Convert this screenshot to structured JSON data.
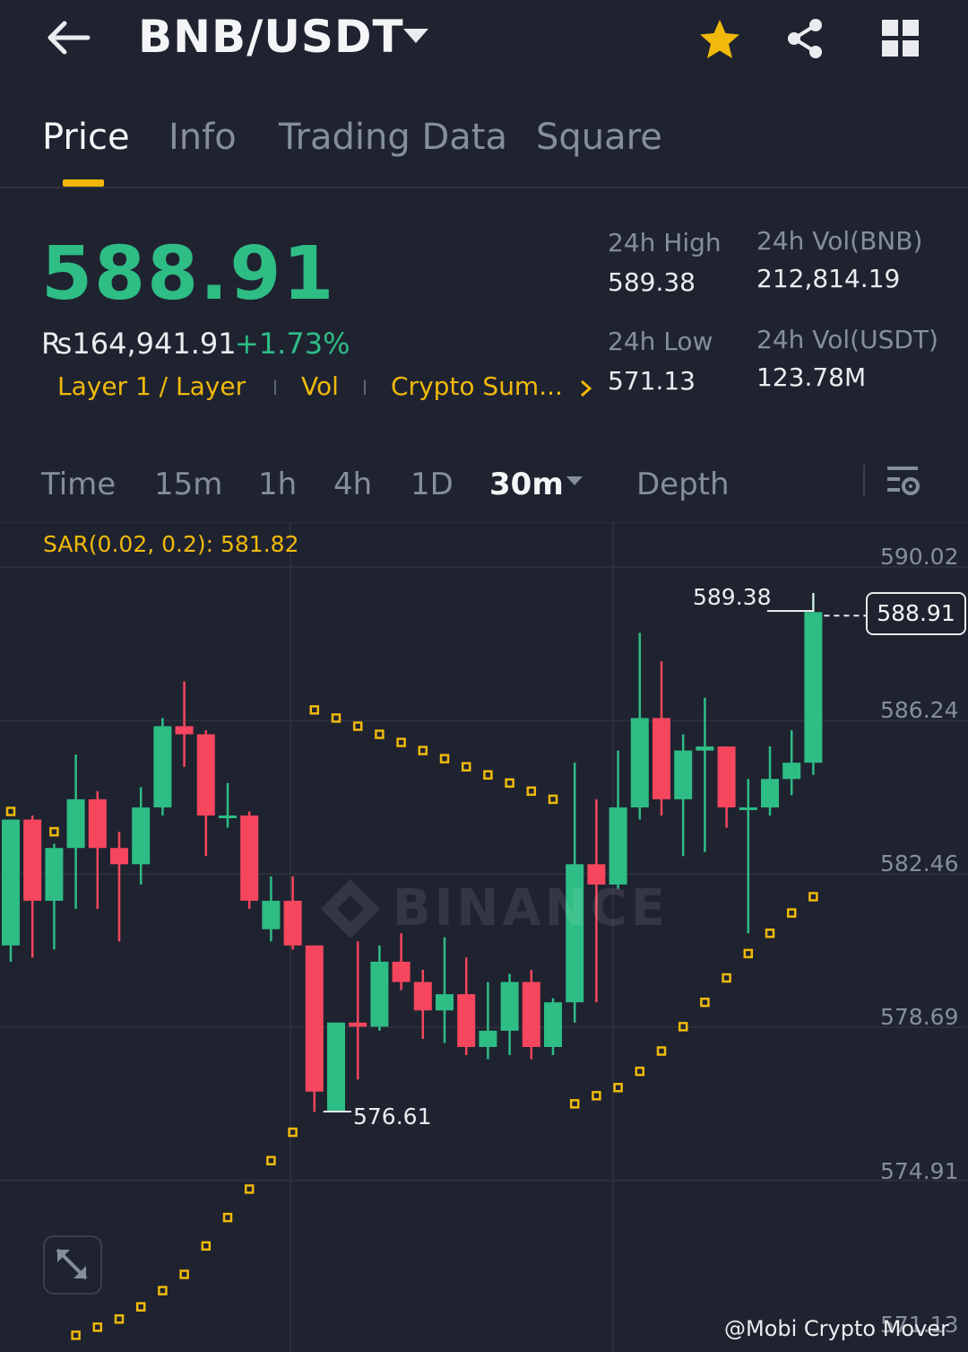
{
  "header": {
    "pair": "BNB/USDT",
    "back_icon": "arrow-left-icon",
    "star_icon": "star-icon",
    "share_icon": "share-icon",
    "grid_icon": "grid-icon"
  },
  "tabs": [
    {
      "label": "Price",
      "active": true
    },
    {
      "label": "Info",
      "active": false
    },
    {
      "label": "Trading Data",
      "active": false
    },
    {
      "label": "Square",
      "active": false
    }
  ],
  "price": {
    "last": "588.91",
    "fiat": "₨164,941.91",
    "change": "+1.73%"
  },
  "tags": [
    "Layer 1 / Layer",
    "Vol",
    "Crypto Sum..."
  ],
  "stats": {
    "high_label": "24h High",
    "high_value": "589.38",
    "low_label": "24h Low",
    "low_value": "571.13",
    "vol_bnb_label": "24h Vol(BNB)",
    "vol_bnb_value": "212,814.19",
    "vol_usdt_label": "24h Vol(USDT)",
    "vol_usdt_value": "123.78M"
  },
  "intervals": [
    {
      "label": "Time",
      "active": false
    },
    {
      "label": "15m",
      "active": false
    },
    {
      "label": "1h",
      "active": false
    },
    {
      "label": "4h",
      "active": false
    },
    {
      "label": "1D",
      "active": false
    },
    {
      "label": "30m",
      "active": true
    },
    {
      "label": "Depth",
      "active": false
    }
  ],
  "chart": {
    "sar_label": "SAR(0.02, 0.2): 581.82",
    "current_price": "588.91",
    "high_marker": "589.38",
    "low_marker": "576.61",
    "watermark": "BINANCE",
    "credit": "@Mobi Crypto Mover",
    "y_labels": [
      "590.02",
      "586.24",
      "582.46",
      "578.69",
      "574.91",
      "571.13"
    ]
  },
  "colors": {
    "background": "#1f2330",
    "up": "#2ebd85",
    "down": "#f6465d",
    "accent": "#f0b90b"
  },
  "chart_data": {
    "type": "candlestick",
    "title": "",
    "ylim": [
      570.0,
      591.0
    ],
    "y_ticks": [
      590.02,
      586.24,
      582.46,
      578.69,
      574.91,
      571.13
    ],
    "candles": [
      {
        "o": 580.7,
        "h": 583.7,
        "l": 580.3,
        "c": 583.8
      },
      {
        "o": 583.8,
        "h": 583.9,
        "l": 580.4,
        "c": 581.8
      },
      {
        "o": 581.8,
        "h": 583.2,
        "l": 580.6,
        "c": 583.1
      },
      {
        "o": 583.1,
        "h": 585.4,
        "l": 581.6,
        "c": 584.3
      },
      {
        "o": 584.3,
        "h": 584.5,
        "l": 581.6,
        "c": 583.1
      },
      {
        "o": 583.1,
        "h": 583.5,
        "l": 580.8,
        "c": 582.7
      },
      {
        "o": 582.7,
        "h": 584.6,
        "l": 582.2,
        "c": 584.1
      },
      {
        "o": 584.1,
        "h": 586.3,
        "l": 583.9,
        "c": 586.1
      },
      {
        "o": 586.1,
        "h": 587.2,
        "l": 585.1,
        "c": 585.9
      },
      {
        "o": 585.9,
        "h": 586.0,
        "l": 582.9,
        "c": 583.9
      },
      {
        "o": 583.9,
        "h": 584.7,
        "l": 583.6,
        "c": 583.9
      },
      {
        "o": 583.9,
        "h": 584.0,
        "l": 581.6,
        "c": 581.8
      },
      {
        "o": 581.1,
        "h": 582.4,
        "l": 580.8,
        "c": 581.8
      },
      {
        "o": 581.8,
        "h": 582.4,
        "l": 580.6,
        "c": 580.7
      },
      {
        "o": 580.7,
        "h": 580.6,
        "l": 576.6,
        "c": 577.1
      },
      {
        "o": 576.6,
        "h": 578.7,
        "l": 576.8,
        "c": 578.8
      },
      {
        "o": 578.8,
        "h": 580.8,
        "l": 577.4,
        "c": 578.7
      },
      {
        "o": 578.7,
        "h": 580.7,
        "l": 578.6,
        "c": 580.3
      },
      {
        "o": 580.3,
        "h": 581.0,
        "l": 579.6,
        "c": 579.8
      },
      {
        "o": 579.8,
        "h": 580.1,
        "l": 578.4,
        "c": 579.1
      },
      {
        "o": 579.1,
        "h": 580.9,
        "l": 578.3,
        "c": 579.5
      },
      {
        "o": 579.5,
        "h": 580.4,
        "l": 578.0,
        "c": 578.2
      },
      {
        "o": 578.2,
        "h": 579.8,
        "l": 577.9,
        "c": 578.6
      },
      {
        "o": 578.6,
        "h": 580.0,
        "l": 578.0,
        "c": 579.8
      },
      {
        "o": 579.8,
        "h": 580.1,
        "l": 577.9,
        "c": 578.2
      },
      {
        "o": 578.2,
        "h": 579.4,
        "l": 578.0,
        "c": 579.3
      },
      {
        "o": 579.3,
        "h": 585.2,
        "l": 578.8,
        "c": 582.7
      },
      {
        "o": 582.7,
        "h": 584.3,
        "l": 579.3,
        "c": 582.2
      },
      {
        "o": 582.2,
        "h": 585.5,
        "l": 582.1,
        "c": 584.1
      },
      {
        "o": 584.1,
        "h": 588.4,
        "l": 583.8,
        "c": 586.3
      },
      {
        "o": 586.3,
        "h": 587.7,
        "l": 583.9,
        "c": 584.3
      },
      {
        "o": 584.3,
        "h": 585.9,
        "l": 582.9,
        "c": 585.5
      },
      {
        "o": 585.5,
        "h": 586.8,
        "l": 583.0,
        "c": 585.6
      },
      {
        "o": 585.6,
        "h": 585.6,
        "l": 583.6,
        "c": 584.1
      },
      {
        "o": 584.1,
        "h": 584.8,
        "l": 581.0,
        "c": 584.1
      },
      {
        "o": 584.1,
        "h": 585.6,
        "l": 583.9,
        "c": 584.8
      },
      {
        "o": 584.8,
        "h": 586.0,
        "l": 584.4,
        "c": 585.2
      },
      {
        "o": 585.2,
        "h": 589.38,
        "l": 584.9,
        "c": 588.91
      }
    ],
    "sar": [
      [
        0,
        584.0
      ],
      [
        1,
        583.5
      ],
      [
        2,
        583.5
      ],
      [
        14,
        586.5
      ],
      [
        15,
        586.3
      ],
      [
        16,
        586.1
      ],
      [
        17,
        585.9
      ],
      [
        18,
        585.7
      ],
      [
        19,
        585.5
      ],
      [
        20,
        585.3
      ],
      [
        21,
        585.1
      ],
      [
        22,
        584.9
      ],
      [
        23,
        584.7
      ],
      [
        24,
        584.5
      ],
      [
        25,
        584.3
      ],
      [
        26,
        576.8
      ],
      [
        27,
        577.0
      ],
      [
        28,
        577.2
      ],
      [
        29,
        577.6
      ],
      [
        30,
        578.1
      ],
      [
        31,
        578.7
      ],
      [
        32,
        579.3
      ],
      [
        33,
        579.9
      ],
      [
        34,
        580.5
      ],
      [
        35,
        581.0
      ],
      [
        36,
        581.5
      ],
      [
        37,
        581.9
      ]
    ],
    "sar_left": [
      [
        3,
        571.1
      ],
      [
        4,
        571.3
      ],
      [
        5,
        571.5
      ],
      [
        6,
        571.8
      ],
      [
        7,
        572.2
      ],
      [
        8,
        572.6
      ],
      [
        9,
        573.3
      ],
      [
        10,
        574.0
      ],
      [
        11,
        574.7
      ],
      [
        12,
        575.4
      ],
      [
        13,
        576.1
      ]
    ]
  }
}
